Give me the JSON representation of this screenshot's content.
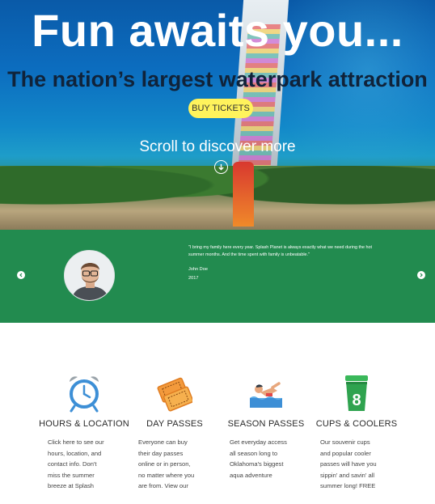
{
  "hero": {
    "title": "Fun awaits you...",
    "subtitle": "The nation’s largest waterpark attraction",
    "cta_label": "BUY TICKETS",
    "scroll_text": "Scroll to discover more"
  },
  "testimonial": {
    "quote": "\"I bring my family here every year. Splash Planet is always exactly what we need during the hot summer months. And the time spent with family is unbeatable.\"",
    "name": "John Doe",
    "year": "2017"
  },
  "features": [
    {
      "title": "HOURS & LOCATION",
      "icon": "alarm-clock-icon",
      "description": "Click here to see our hours, location, and contact info. Don't miss the summer breeze at Splash"
    },
    {
      "title": "DAY PASSES",
      "icon": "tickets-icon",
      "description": "Everyone can buy their day passes online or in person, no matter where you are from. View our"
    },
    {
      "title": "SEASON PASSES",
      "icon": "swimmer-icon",
      "description": "Get everyday access all season long to Oklahoma's biggest aqua adventure"
    },
    {
      "title": "CUPS & COOLERS",
      "icon": "cup-icon",
      "description": "Our souvenir cups and popular cooler passes will have you sippin' and savin' all summer long! FREE"
    }
  ],
  "colors": {
    "testimonial_bg": "#228b4f",
    "cta_bg": "#fff35c",
    "clock_blue": "#3d8fd6",
    "cup_green": "#2fa34f"
  }
}
